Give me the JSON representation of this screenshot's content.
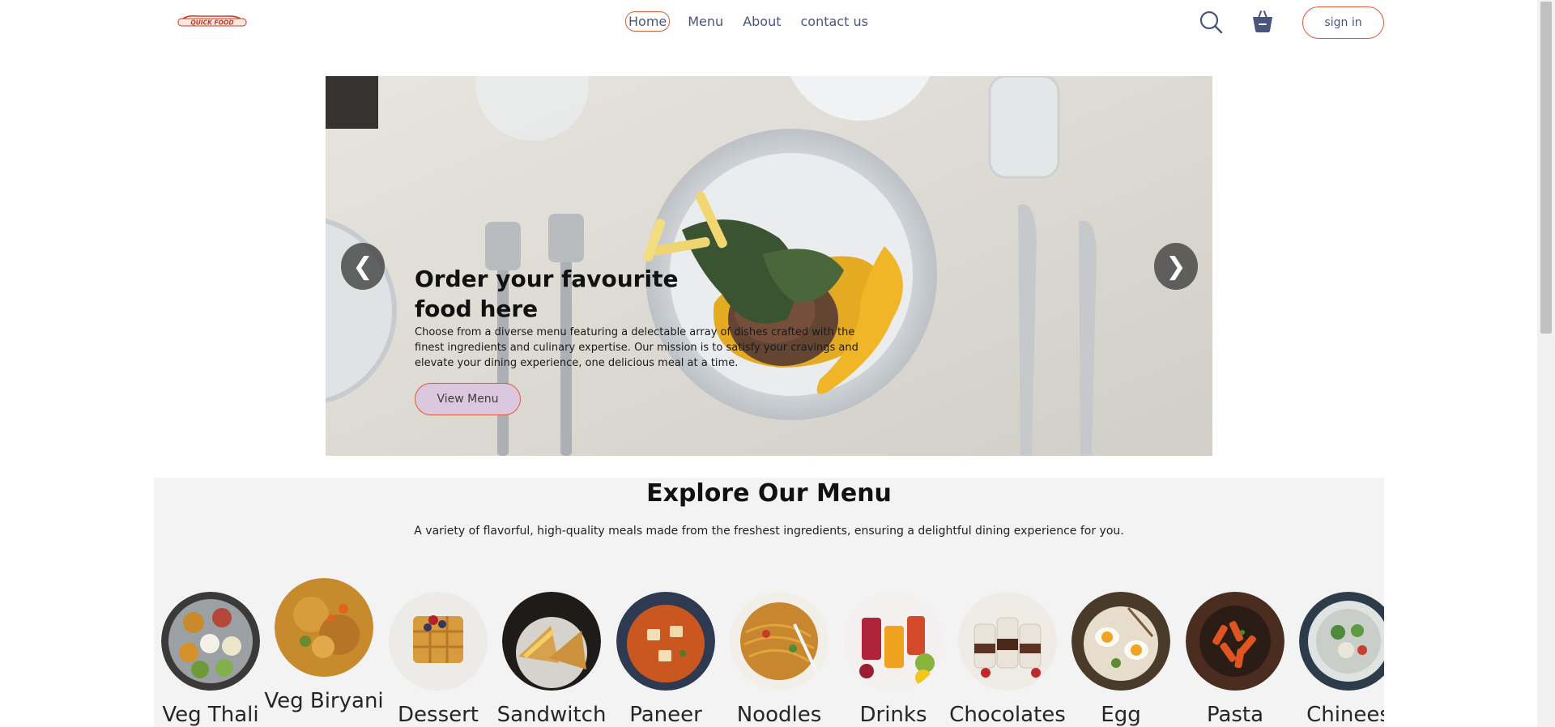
{
  "brand": {
    "logo_text": "QUICK FOOD"
  },
  "nav": {
    "links": [
      "Home",
      "Menu",
      "About",
      "contact us"
    ],
    "active": "Home",
    "signin_label": "sign in"
  },
  "hero": {
    "title": "Order your favourite food here",
    "description": "Choose from a diverse menu featuring a delectable array of dishes crafted with the finest ingredients and culinary expertise. Our mission is to satisfy your cravings and elevate your dining experience, one delicious meal at a time.",
    "cta_label": "View Menu",
    "prev_glyph": "❮",
    "next_glyph": "❯"
  },
  "menu": {
    "title": "Explore Our Menu",
    "subtitle": "A variety of flavorful, high-quality meals made from the freshest ingredients, ensuring a delightful dining experience for you.",
    "items": [
      {
        "label": "Veg Thali",
        "icon": "veg-thali-image"
      },
      {
        "label": "Veg Biryani",
        "icon": "veg-biryani-image"
      },
      {
        "label": "Dessert",
        "icon": "dessert-image"
      },
      {
        "label": "Sandwitch",
        "icon": "sandwitch-image"
      },
      {
        "label": "Paneer",
        "icon": "paneer-image"
      },
      {
        "label": "Noodles",
        "icon": "noodles-image"
      },
      {
        "label": "Drinks",
        "icon": "drinks-image"
      },
      {
        "label": "Chocolates",
        "icon": "chocolates-image"
      },
      {
        "label": "Egg",
        "icon": "egg-image"
      },
      {
        "label": "Pasta",
        "icon": "pasta-image"
      },
      {
        "label": "Chinees",
        "icon": "chinees-image"
      }
    ]
  },
  "colors": {
    "accent": "#e0593c",
    "nav_text": "#49557e",
    "cta_bg": "#dcc8de",
    "section_bg": "#f3f3f3"
  }
}
